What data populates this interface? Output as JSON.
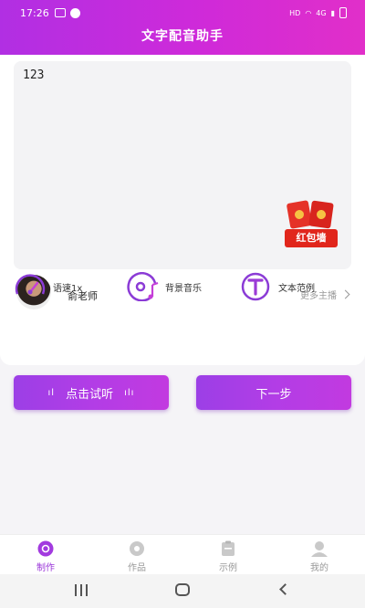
{
  "status": {
    "time": "17:26",
    "network": "HD",
    "signal_label": "4G"
  },
  "header": {
    "title": "文字配音助手"
  },
  "editor": {
    "text": "123"
  },
  "promo": {
    "label": "红包墙"
  },
  "anchor": {
    "name": "俞老师",
    "more_label": "更多主播"
  },
  "options": [
    {
      "label": "语速1x",
      "icon": "speed-gauge-icon"
    },
    {
      "label": "背景音乐",
      "icon": "music-disc-icon"
    },
    {
      "label": "文本范例",
      "icon": "text-t-icon"
    }
  ],
  "actions": {
    "listen_label": "点击试听",
    "next_label": "下一步"
  },
  "tabs": [
    {
      "label": "制作",
      "active": true
    },
    {
      "label": "作品",
      "active": false
    },
    {
      "label": "示例",
      "active": false
    },
    {
      "label": "我的",
      "active": false
    }
  ],
  "colors": {
    "accent": "#b12fe3",
    "accent_end": "#e12fc9",
    "promo_red": "#e1261c"
  }
}
